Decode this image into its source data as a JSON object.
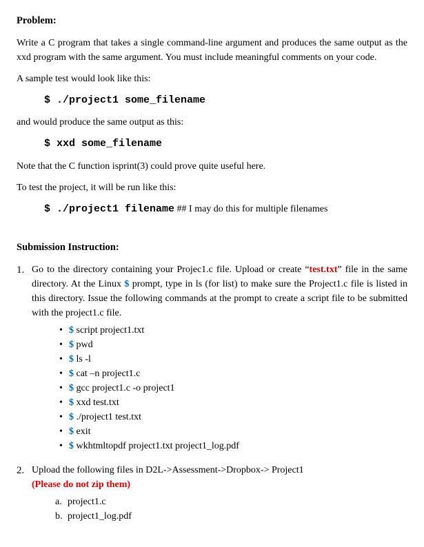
{
  "problem": {
    "heading": "Problem:",
    "para1": "Write a C program that takes a single command-line argument and produces the same output as the xxd program with the same argument. You must include meaningful comments on your code.",
    "para2": "A sample test would look like this:",
    "code1": "$ ./project1 some_filename",
    "para3": "and would produce the same output as this:",
    "code2": "$ xxd some_filename",
    "para4": "Note that the C function isprint(3) could prove quite useful here.",
    "para5": "To test the project, it will be run like this:",
    "code3_cmd": "$ ./project1 filename",
    "code3_comment": "   ## I may do this for multiple filenames"
  },
  "submission": {
    "heading": "Submission Instruction:",
    "item1_number": "1.",
    "item1_pre": "Go to the directory containing your Projec1.c file. Upload or create “",
    "item1_file": "test.txt",
    "item1_post": "” file in the same directory. At the Linux ",
    "item1_dollar": "$",
    "item1_after_dollar": " prompt, type in ls (for list) to make sure the Project1.c file is listed in this directory. Issue the following commands at the prompt to create a script file to be submitted with the project1.c file.",
    "cmds": [
      {
        "d": "$",
        "t": " script project1.txt"
      },
      {
        "d": "$",
        "t": " pwd"
      },
      {
        "d": "$",
        "t": " ls -l"
      },
      {
        "d": "$",
        "t": " cat –n project1.c"
      },
      {
        "d": "$",
        "t": " gcc project1.c -o project1"
      },
      {
        "d": "$",
        "t": " xxd test.txt"
      },
      {
        "d": "$",
        "t": " ./project1 test.txt"
      },
      {
        "d": "$",
        "t": " exit"
      },
      {
        "d": "$",
        "t": " wkhtmltopdf project1.txt project1_log.pdf"
      }
    ],
    "item2_number": "2.",
    "item2_text": " Upload the following files in D2L->Assessment->Dropbox-> Project1",
    "item2_warn": "(Please do not zip them)",
    "files": [
      {
        "m": "a.",
        "t": "project1.c"
      },
      {
        "m": "b.",
        "t": "project1_log.pdf"
      }
    ]
  }
}
